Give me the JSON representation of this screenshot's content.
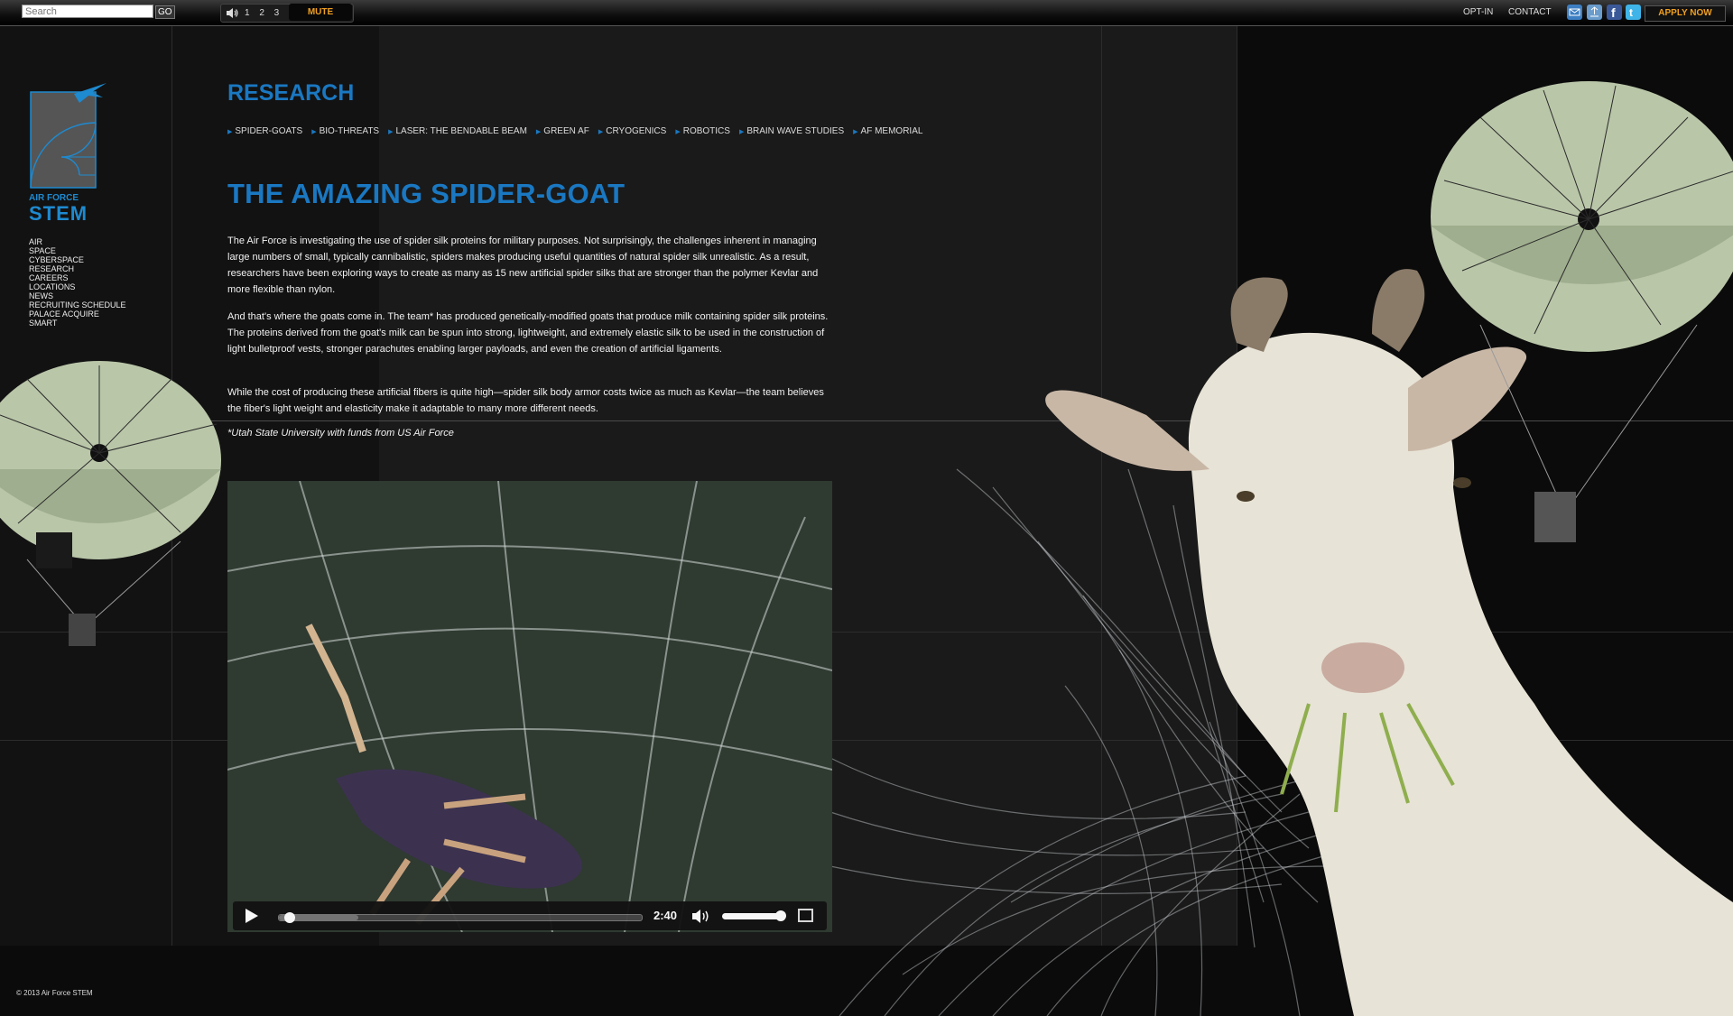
{
  "topbar": {
    "search_placeholder": "Search",
    "go_label": "GO",
    "volume_levels": "1 2 3 4",
    "mute_label": "MUTE",
    "links": [
      "OPT-IN",
      "CONTACT"
    ],
    "social_icons": [
      "email-icon",
      "share-icon",
      "facebook-icon",
      "twitter-icon"
    ],
    "apply_label": "APPLY NOW"
  },
  "logo": {
    "line1": "AIR FORCE",
    "line2": "STEM"
  },
  "leftnav": {
    "items": [
      "AIR",
      "SPACE",
      "CYBERSPACE",
      "RESEARCH",
      "CAREERS",
      "LOCATIONS",
      "NEWS",
      "RECRUITING SCHEDULE",
      "PALACE ACQUIRE",
      "SMART"
    ]
  },
  "main": {
    "section_title": "RESEARCH",
    "subnav": [
      "SPIDER-GOATS",
      "BIO-THREATS",
      "LASER: THE BENDABLE BEAM",
      "GREEN AF",
      "CRYOGENICS",
      "ROBOTICS",
      "BRAIN WAVE STUDIES",
      "AF MEMORIAL"
    ],
    "article_title": "THE AMAZING SPIDER-GOAT",
    "paragraphs": [
      "The Air Force is investigating the use of spider silk proteins for military purposes. Not surprisingly, the challenges inherent in managing large numbers of small, typically cannibalistic, spiders makes producing useful quantities of natural spider silk unrealistic. As a result, researchers have been exploring ways to create as many as 15 new artificial spider silks that are stronger than the polymer Kevlar and more flexible than nylon.",
      "And that's where the goats come in. The team* has produced genetically-modified goats that produce milk containing spider silk proteins. The proteins derived from the goat's milk can be spun into strong, lightweight, and extremely elastic silk to be used in the construction of light bulletproof vests, stronger parachutes enabling larger payloads, and even the creation of artificial ligaments.",
      "While the cost of producing these artificial fibers is quite high—spider silk body armor costs twice as much as Kevlar—the team believes the fiber's light weight and elasticity make it adaptable to many more different needs."
    ],
    "footnote": "*Utah State University with funds from US Air Force"
  },
  "video": {
    "time": "2:40",
    "progress": 0.02,
    "buffered": 0.22,
    "volume": 1.0
  },
  "footer": {
    "copyright": "© 2013 Air Force STEM"
  },
  "colors": {
    "accent_blue": "#1a78c2",
    "orange": "#f0a020",
    "parachute": "#b9c6a8"
  }
}
